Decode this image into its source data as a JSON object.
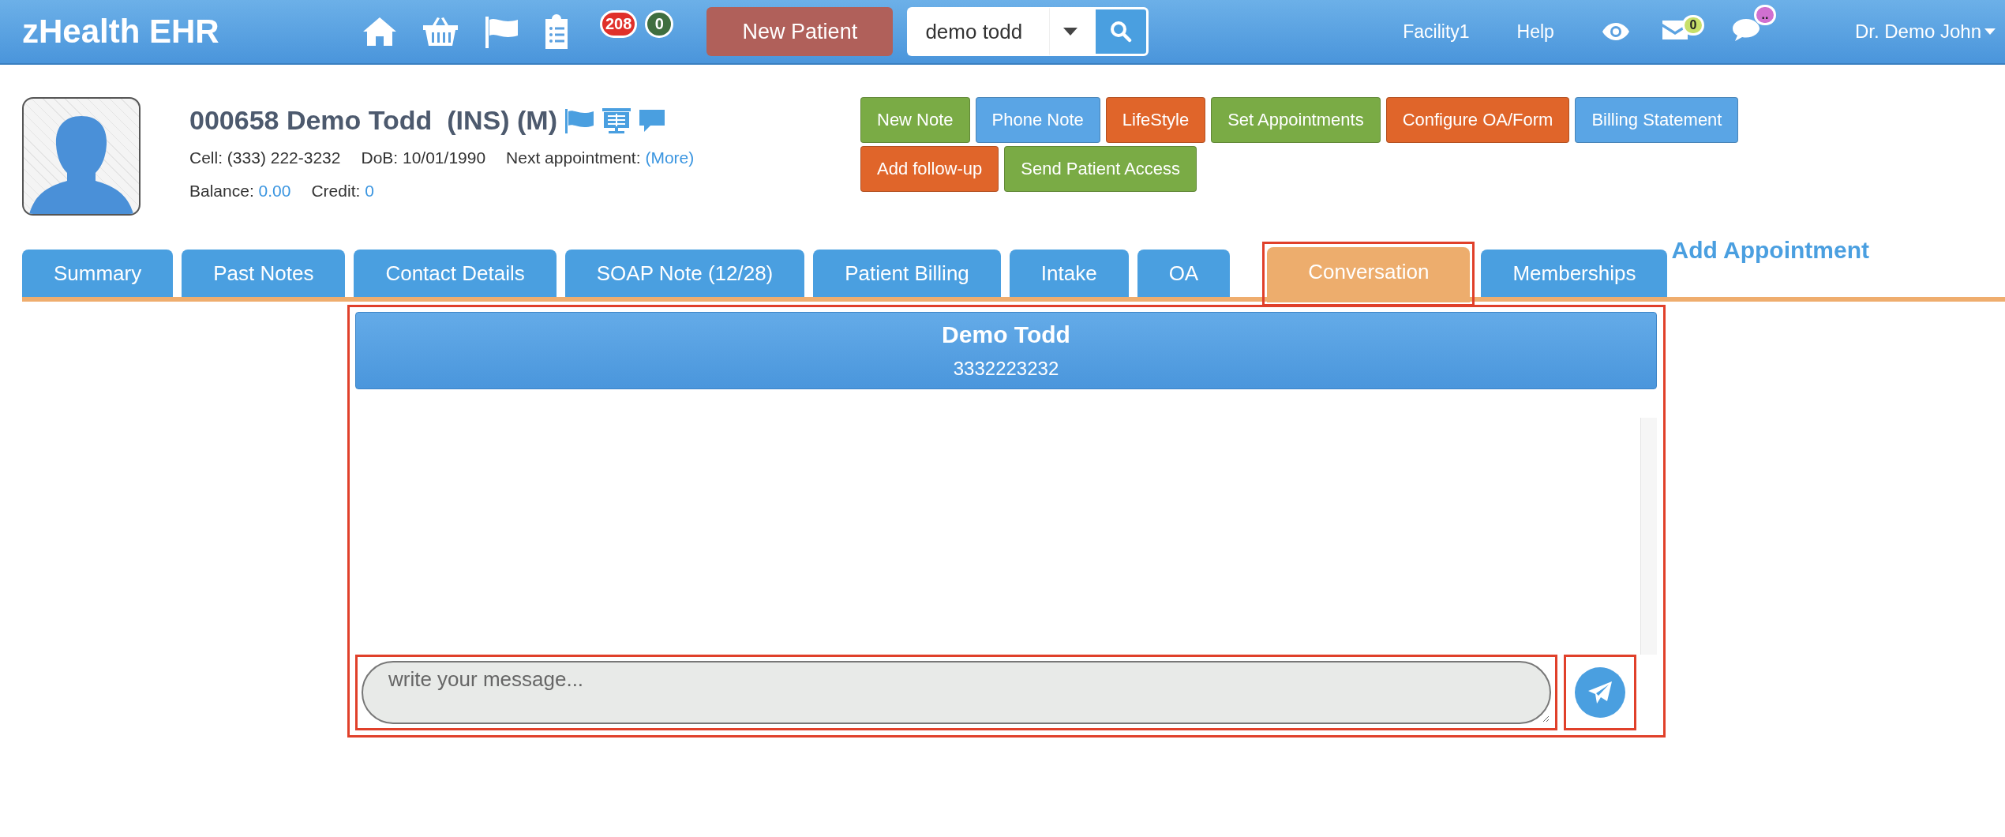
{
  "app": {
    "title": "zHealth EHR"
  },
  "nav_badges": [
    {
      "count": "208",
      "color": "#e0302a"
    },
    {
      "count": "0",
      "color": "#3f6e3f"
    }
  ],
  "new_patient_button": "New Patient",
  "search": {
    "value": "demo todd"
  },
  "header_links": [
    "Facility1",
    "Help"
  ],
  "mail_badge": {
    "count": "0",
    "color": "#c8e06a"
  },
  "chat_badge": {
    "count": "..",
    "color": "#d070d0"
  },
  "user_menu": "Dr. Demo John",
  "patient": {
    "title": "000658 Demo Todd  (INS) (M)",
    "details": [
      {
        "label": "Cell:",
        "value": "(333) 222-3232",
        "kind": "text"
      },
      {
        "label": "DoB:",
        "value": "10/01/1990",
        "kind": "text"
      },
      {
        "label": "Next appointment:",
        "value": "(More)",
        "kind": "link"
      }
    ],
    "balances": [
      {
        "label": "Balance:",
        "value": "0.00",
        "kind": "link"
      },
      {
        "label": "Credit:",
        "value": "0",
        "kind": "link"
      }
    ]
  },
  "actions": [
    [
      {
        "label": "New Note",
        "color": "#7aab45"
      },
      {
        "label": "Phone Note",
        "color": "#5aa5e5"
      },
      {
        "label": "LifeStyle",
        "color": "#e0652a"
      },
      {
        "label": "Set Appointments",
        "color": "#7aab45"
      },
      {
        "label": "Configure OA/Form",
        "color": "#e0652a"
      },
      {
        "label": "Billing Statement",
        "color": "#5aa5e5"
      }
    ],
    [
      {
        "label": "Add follow-up",
        "color": "#e0652a"
      },
      {
        "label": "Send Patient Access",
        "color": "#7aab45"
      }
    ]
  ],
  "tabs": [
    {
      "label": "Summary",
      "selected": false
    },
    {
      "label": "Past Notes",
      "selected": false
    },
    {
      "label": "Contact Details",
      "selected": false
    },
    {
      "label": "SOAP Note (12/28)",
      "selected": false
    },
    {
      "label": "Patient Billing",
      "selected": false
    },
    {
      "label": "Intake",
      "selected": false
    },
    {
      "label": "OA",
      "selected": false
    },
    {
      "label": "Conversation",
      "selected": true
    },
    {
      "label": "Memberships",
      "selected": false
    }
  ],
  "add_appointment": "Add Appointment",
  "conversation": {
    "name": "Demo Todd",
    "phone": "3332223232",
    "message": {
      "placeholder": "write your message..."
    }
  }
}
